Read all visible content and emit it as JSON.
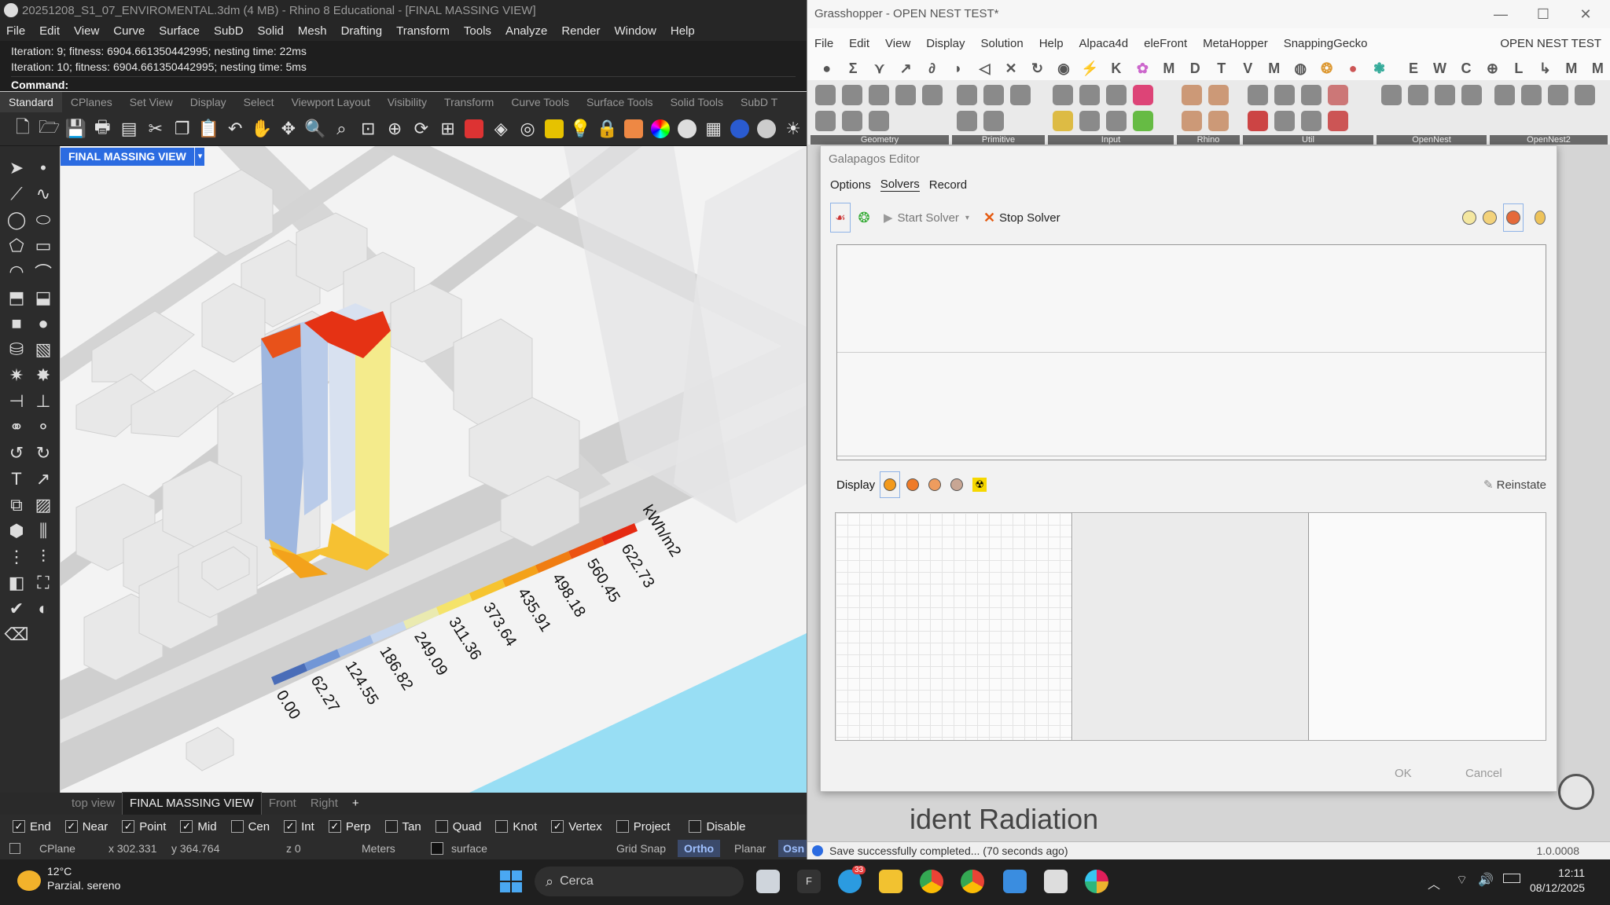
{
  "rhino": {
    "title": "20251208_S1_07_ENVIROMENTAL.3dm (4 MB) - Rhino 8 Educational - [FINAL MASSING VIEW]",
    "menu": [
      "File",
      "Edit",
      "View",
      "Curve",
      "Surface",
      "SubD",
      "Solid",
      "Mesh",
      "Drafting",
      "Transform",
      "Tools",
      "Analyze",
      "Render",
      "Window",
      "Help"
    ],
    "command_lines": [
      "Iteration: 9; fitness: 6904.661350442995; nesting time: 22ms",
      "Iteration: 10; fitness: 6904.661350442995; nesting time: 5ms"
    ],
    "command_prompt": "Command:",
    "toolbar_tabs": [
      "Standard",
      "CPlanes",
      "Set View",
      "Display",
      "Select",
      "Viewport Layout",
      "Visibility",
      "Transform",
      "Curve Tools",
      "Surface Tools",
      "Solid Tools",
      "SubD T"
    ],
    "viewport_name": "FINAL MASSING VIEW",
    "viewport_tabs": [
      "top view",
      "FINAL MASSING VIEW",
      "Front",
      "Right",
      "+"
    ],
    "osnaps": [
      {
        "label": "End",
        "checked": true
      },
      {
        "label": "Near",
        "checked": true
      },
      {
        "label": "Point",
        "checked": true
      },
      {
        "label": "Mid",
        "checked": true
      },
      {
        "label": "Cen",
        "checked": false
      },
      {
        "label": "Int",
        "checked": true
      },
      {
        "label": "Perp",
        "checked": true
      },
      {
        "label": "Tan",
        "checked": false
      },
      {
        "label": "Quad",
        "checked": false
      },
      {
        "label": "Knot",
        "checked": false
      },
      {
        "label": "Vertex",
        "checked": true
      },
      {
        "label": "Project",
        "checked": false
      },
      {
        "label": "Disable",
        "checked": false
      }
    ],
    "status": {
      "cplane": "CPlane",
      "x": "x 302.331",
      "y": "y 364.764",
      "z": "z 0",
      "units": "Meters",
      "layer": "surface",
      "grid_snap": "Grid Snap",
      "ortho": "Ortho",
      "planar": "Planar",
      "osnap": "Osn"
    },
    "legend": {
      "values": [
        "0.00",
        "62.27",
        "124.55",
        "186.82",
        "249.09",
        "311.36",
        "373.64",
        "435.91",
        "498.18",
        "560.45",
        "622.73"
      ],
      "unit": "kWh/m2",
      "colors": [
        "#4a6db8",
        "#7196d6",
        "#a0bbe6",
        "#c6d6ee",
        "#eaeab0",
        "#f5e36a",
        "#f6c430",
        "#f4a21a",
        "#f07d12",
        "#ec5212",
        "#e52a12"
      ]
    }
  },
  "grasshopper": {
    "title": "Grasshopper - OPEN NEST TEST*",
    "menu": [
      "File",
      "Edit",
      "View",
      "Display",
      "Solution",
      "Help",
      "Alpaca4d",
      "eleFront",
      "MetaHopper",
      "SnappingGecko"
    ],
    "doc_name": "OPEN NEST TEST",
    "category_tabs": [
      "Σ",
      "E",
      "W",
      "C",
      "L",
      "M",
      "M",
      "K",
      "M",
      "D",
      "T",
      "V",
      "M"
    ],
    "groups": [
      "Geometry",
      "Primitive",
      "Input",
      "Rhino",
      "Util",
      "OpenNest",
      "OpenNest2"
    ],
    "canvas_text": "ident Radiation",
    "status_message": "Save successfully completed... (70 seconds ago)",
    "version": "1.0.0008"
  },
  "galapagos": {
    "title": "Galapagos Editor",
    "tabs": [
      "Options",
      "Solvers",
      "Record"
    ],
    "start_solver": "Start Solver",
    "stop_solver": "Stop Solver",
    "display_label": "Display",
    "reinstate": "Reinstate",
    "ok": "OK",
    "cancel": "Cancel"
  },
  "taskbar": {
    "temperature": "12°C",
    "weather": "Parzial. sereno",
    "search": "Cerca",
    "time": "12:11",
    "date": "08/12/2025",
    "telegram_badge": "33"
  }
}
